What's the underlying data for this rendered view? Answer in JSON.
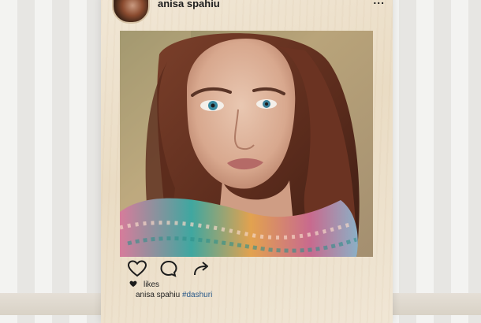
{
  "post": {
    "username": "anisa spahiu",
    "more_icon": "...",
    "photo_icon": "portrait-photo",
    "likes_label": "likes",
    "caption_user": "anisa spahiu",
    "caption_hashtag": "#dashuri"
  },
  "icons": {
    "like": "heart-icon",
    "comment": "comment-icon",
    "share": "share-icon"
  }
}
